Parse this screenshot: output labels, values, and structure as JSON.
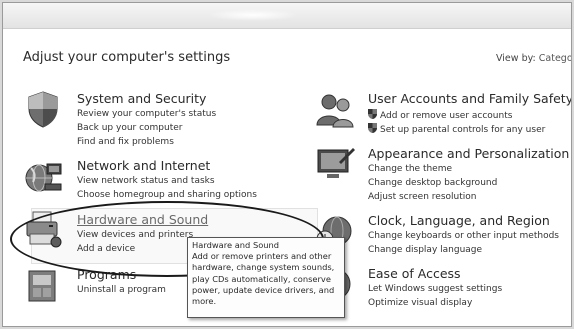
{
  "header": {
    "title": "Adjust your computer's settings",
    "view_by_label": "View by:",
    "view_by_value": "Catego"
  },
  "left_categories": [
    {
      "title": "System and Security",
      "links": [
        "Review your computer's status",
        "Back up your computer",
        "Find and fix problems"
      ]
    },
    {
      "title": "Network and Internet",
      "links": [
        "View network status and tasks",
        "Choose homegroup and sharing options"
      ]
    },
    {
      "title": "Hardware and Sound",
      "links": [
        "View devices and printers",
        "Add a device"
      ]
    },
    {
      "title": "Programs",
      "links": [
        "Uninstall a program"
      ]
    }
  ],
  "right_categories": [
    {
      "title": "User Accounts and Family Safety",
      "links": [
        "Add or remove user accounts",
        "Set up parental controls for any user"
      ]
    },
    {
      "title": "Appearance and Personalization",
      "links": [
        "Change the theme",
        "Change desktop background",
        "Adjust screen resolution"
      ]
    },
    {
      "title": "Clock, Language, and Region",
      "links": [
        "Change keyboards or other input methods",
        "Change display language"
      ]
    },
    {
      "title": "Ease of Access",
      "links": [
        "Let Windows suggest settings",
        "Optimize visual display"
      ]
    }
  ],
  "tooltip": {
    "lines": [
      "Hardware and Sound",
      "Add or remove printers and other",
      "hardware, change system sounds,",
      "play CDs automatically, conserve",
      "power, update device drivers, and",
      "more."
    ]
  }
}
